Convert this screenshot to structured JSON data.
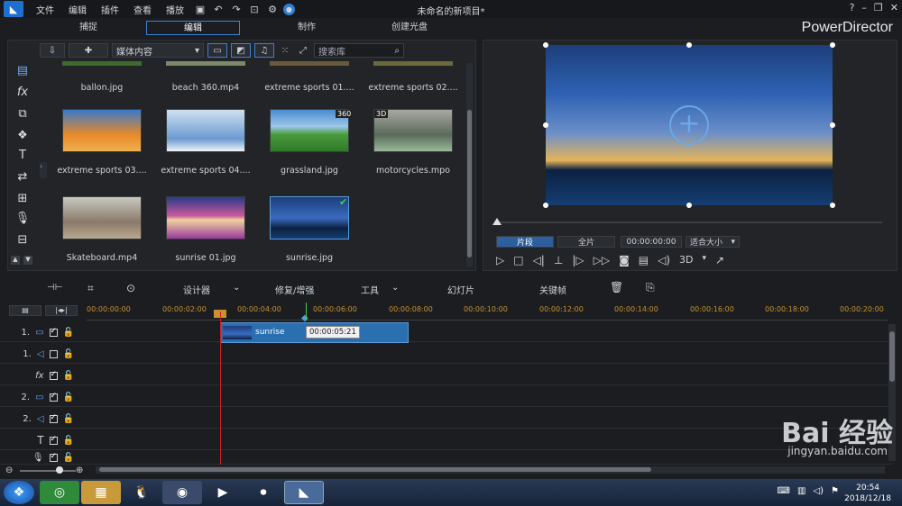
{
  "menu": [
    "文件",
    "编辑",
    "插件",
    "查看",
    "播放"
  ],
  "window_title": "未命名的新项目*",
  "brand": "PowerDirector",
  "modes": [
    "捕捉",
    "编辑",
    "制作",
    "创建光盘"
  ],
  "library": {
    "dropdown": "媒体内容",
    "search_placeholder": "搜索库",
    "row0": [
      "ballon.jpg",
      "beach 360.mp4",
      "extreme sports 01....",
      "extreme sports 02...."
    ],
    "row1": [
      "extreme sports 03....",
      "extreme sports 04....",
      "grassland.jpg",
      "motorcycles.mpo"
    ],
    "row2": [
      "Skateboard.mp4",
      "sunrise 01.jpg",
      "sunrise.jpg"
    ],
    "badge_360": "360",
    "badge_3d": "3D"
  },
  "preview": {
    "seg_clip": "片段",
    "seg_movie": "全片",
    "timecode": "00:00:00:00",
    "fit": "适合大小",
    "mode_3d": "3D"
  },
  "edit_tools": {
    "designer": "设计器",
    "fix": "修复/增强",
    "tools": "工具",
    "slideshow": "幻灯片",
    "keyframe": "关键帧"
  },
  "ruler_ticks": [
    "00:00:00:00",
    "00:00:02:00",
    "00:00:04:00",
    "00:00:06:00",
    "00:00:08:00",
    "00:00:10:00",
    "00:00:12:00",
    "00:00:14:00",
    "00:00:16:00",
    "00:00:18:00",
    "00:00:20:00"
  ],
  "tracks": [
    {
      "label": "1."
    },
    {
      "label": "1."
    },
    {
      "label": ""
    },
    {
      "label": "2."
    },
    {
      "label": "2."
    },
    {
      "label": ""
    },
    {
      "label": ""
    }
  ],
  "clip": {
    "name": "sunrise",
    "tooltip": "00:00:05:21"
  },
  "clock": {
    "time": "20:54",
    "date": "2018/12/18"
  },
  "watermark": {
    "main": "Bai 经验",
    "sub": "jingyan.baidu.com"
  },
  "colors": {
    "accent": "#3b82d6",
    "playhead": "#d02020",
    "ruler_text": "#c8932f"
  }
}
